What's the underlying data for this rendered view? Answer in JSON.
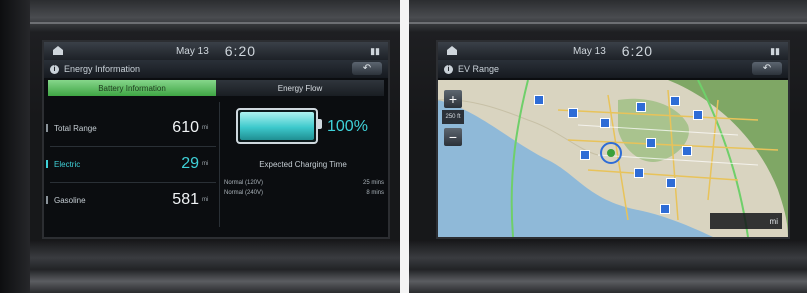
{
  "left_screen": {
    "status": {
      "date": "May 13",
      "time": "6:20"
    },
    "title": "Energy Information",
    "back_label": "↶",
    "tabs": [
      {
        "label": "Battery Information",
        "active": true
      },
      {
        "label": "Energy Flow",
        "active": false
      }
    ],
    "rows": [
      {
        "label": "Total Range",
        "value": "610",
        "unit": "mi"
      },
      {
        "label": "Electric",
        "value": "29",
        "unit": "mi"
      },
      {
        "label": "Gasoline",
        "value": "581",
        "unit": "mi"
      }
    ],
    "battery": {
      "percent_text": "100%",
      "level": 1.0
    },
    "charging": {
      "title": "Expected Charging Time",
      "rows": [
        {
          "label": "Normal (120V)",
          "value": "25 mins"
        },
        {
          "label": "Normal (240V)",
          "value": "8 mins"
        }
      ]
    }
  },
  "right_screen": {
    "status": {
      "date": "May 13",
      "time": "6:20"
    },
    "title": "EV Range",
    "back_label": "↶",
    "zoom_in": "+",
    "zoom_out": "−",
    "scale": "250 ft",
    "badge": "mi"
  },
  "colors": {
    "accent_green": "#5cc462",
    "accent_cyan": "#3fd1d8",
    "map_water": "#8fb9d8",
    "map_land": "#d9d4c0"
  },
  "icons": [
    "home-icon",
    "signal-icon",
    "info-icon",
    "back-icon",
    "battery-icon",
    "zoom-in-icon",
    "zoom-out-icon",
    "charging-station-icon"
  ]
}
